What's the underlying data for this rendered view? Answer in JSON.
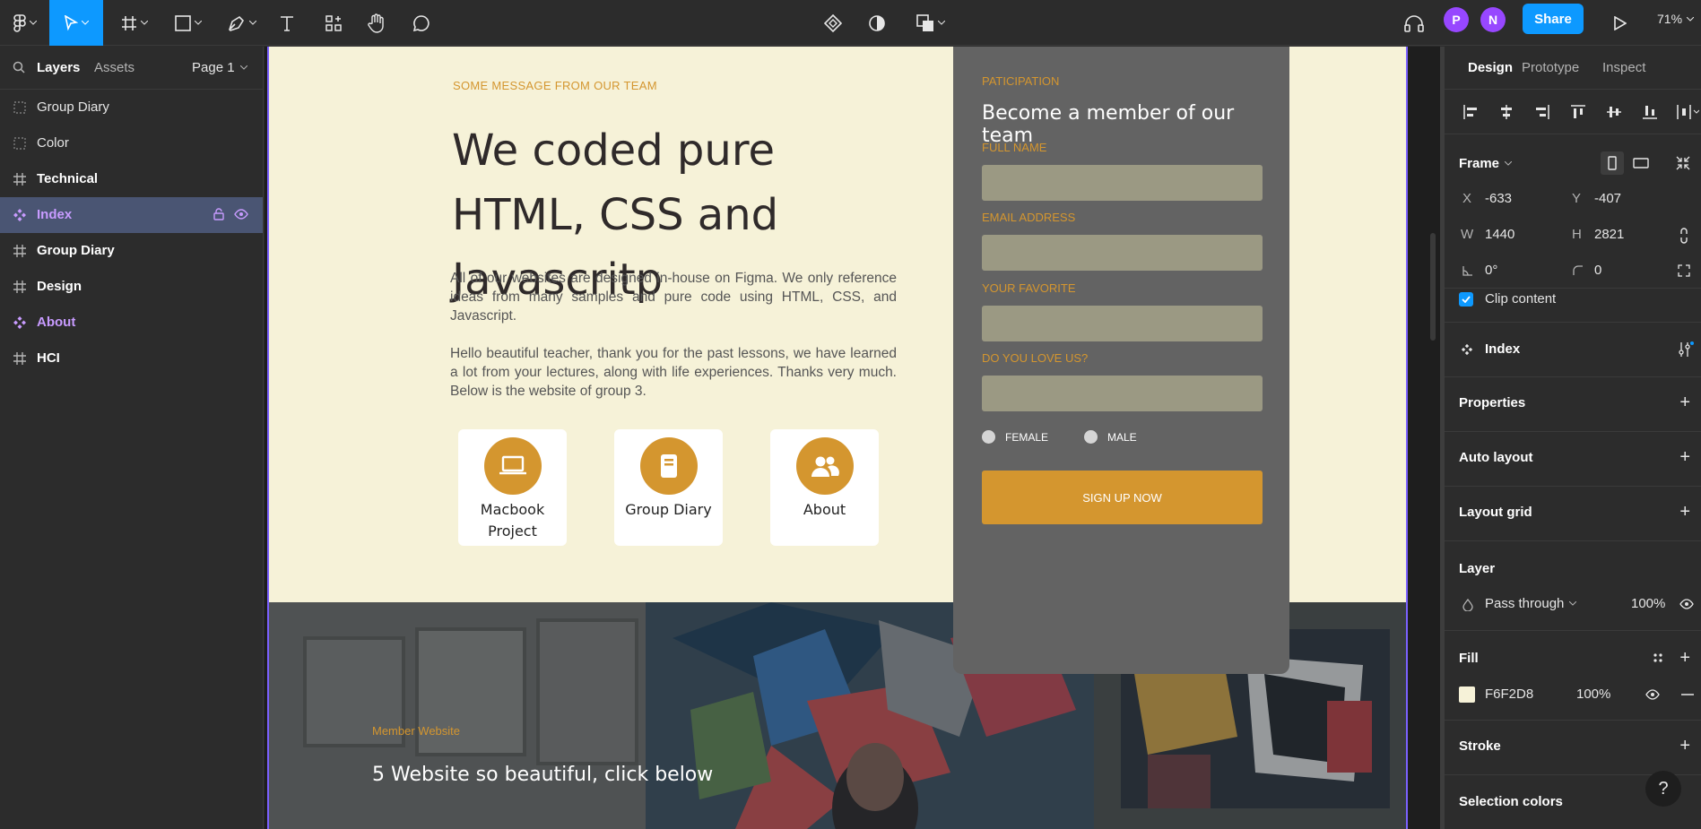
{
  "toolbar": {
    "share_label": "Share",
    "avatars": [
      "P",
      "N"
    ],
    "zoom": "71%"
  },
  "left_panel": {
    "tabs": [
      "Layers",
      "Assets"
    ],
    "page": "Page 1",
    "layers": [
      {
        "name": "Group Diary",
        "kind": "section"
      },
      {
        "name": "Color",
        "kind": "section"
      },
      {
        "name": "Technical",
        "kind": "frame"
      },
      {
        "name": "Index",
        "kind": "component",
        "selected": true
      },
      {
        "name": "Group Diary",
        "kind": "frame"
      },
      {
        "name": "Design",
        "kind": "frame"
      },
      {
        "name": "About",
        "kind": "component"
      },
      {
        "name": "HCI",
        "kind": "frame"
      }
    ]
  },
  "canvas": {
    "hero": {
      "tag": "SOME MESSAGE FROM OUR TEAM",
      "title": "We coded pure HTML, CSS and Javascritp",
      "paragraph1": "All of our websites are designed in-house on Figma. We only reference ideas from many samples and pure code using HTML, CSS, and Javascript.",
      "paragraph2": "Hello beautiful teacher, thank you for the past lessons, we have learned a lot from your lectures, along with life experiences. Thanks very much. Below is the website of group 3."
    },
    "cards": [
      {
        "label": "Macbook Project",
        "icon": "laptop-icon"
      },
      {
        "label": "Group Diary",
        "icon": "notebook-icon"
      },
      {
        "label": "About",
        "icon": "users-icon"
      }
    ],
    "form": {
      "tag": "PATICIPATION",
      "title": "Become a  member of our team",
      "fields": [
        "FULL NAME",
        "EMAIL ADDRESS",
        "YOUR FAVORITE",
        "DO YOU LOVE US?"
      ],
      "radios": [
        "FEMALE",
        "MALE"
      ],
      "button": "SIGN UP NOW"
    },
    "member": {
      "tag": "Member Website",
      "title": "5 Website so beautiful, click below"
    }
  },
  "right_panel": {
    "tabs": [
      "Design",
      "Prototype",
      "Inspect"
    ],
    "frame_label": "Frame",
    "x": {
      "label": "X",
      "value": "-633"
    },
    "y": {
      "label": "Y",
      "value": "-407"
    },
    "w": {
      "label": "W",
      "value": "1440"
    },
    "h": {
      "label": "H",
      "value": "2821"
    },
    "rotation": "0°",
    "radius": "0",
    "clip_content": "Clip content",
    "component_name": "Index",
    "sections": {
      "properties": "Properties",
      "auto_layout": "Auto layout",
      "layout_grid": "Layout grid",
      "layer": "Layer",
      "fill": "Fill",
      "stroke": "Stroke",
      "selection_colors": "Selection colors"
    },
    "layer_blend": "Pass through",
    "layer_opacity": "100%",
    "fill_hex": "F6F2D8",
    "fill_opacity": "100%",
    "help": "?"
  },
  "colors": {
    "accent": "#0d99ff",
    "component": "#c89bff",
    "frame_bg": "#f6f2d8",
    "brand_orange": "#d4962f"
  }
}
